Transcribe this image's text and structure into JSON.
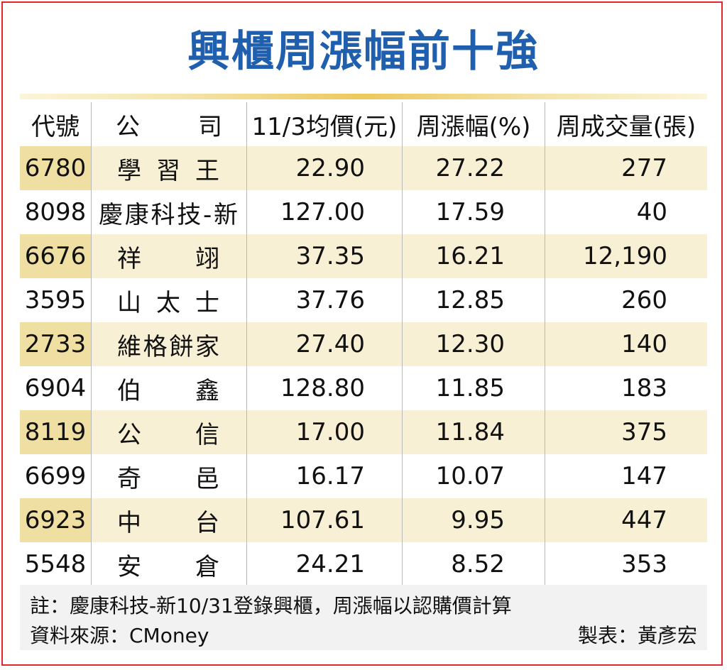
{
  "title": "興櫃周漲幅前十強",
  "headers": [
    "代號",
    "公　　司",
    "11/3均價(元)",
    "周漲幅(%)",
    "周成交量(張)"
  ],
  "chart_data": {
    "type": "table",
    "title": "興櫃周漲幅前十強",
    "columns": [
      "代號",
      "公司",
      "11/3均價(元)",
      "周漲幅(%)",
      "周成交量(張)"
    ],
    "rows": [
      {
        "code": "6780",
        "company": "學習王",
        "price": "22.90",
        "change": "27.22",
        "volume": "277"
      },
      {
        "code": "8098",
        "company": "慶康科技-新",
        "price": "127.00",
        "change": "17.59",
        "volume": "40"
      },
      {
        "code": "6676",
        "company": "祥翊",
        "price": "37.35",
        "change": "16.21",
        "volume": "12,190"
      },
      {
        "code": "3595",
        "company": "山太士",
        "price": "37.76",
        "change": "12.85",
        "volume": "260"
      },
      {
        "code": "2733",
        "company": "維格餅家",
        "price": "27.40",
        "change": "12.30",
        "volume": "140"
      },
      {
        "code": "6904",
        "company": "伯鑫",
        "price": "128.80",
        "change": "11.85",
        "volume": "183"
      },
      {
        "code": "8119",
        "company": "公信",
        "price": "17.00",
        "change": "11.84",
        "volume": "375"
      },
      {
        "code": "6699",
        "company": "奇邑",
        "price": "16.17",
        "change": "10.07",
        "volume": "147"
      },
      {
        "code": "6923",
        "company": "中台",
        "price": "107.61",
        "change": "9.95",
        "volume": "447"
      },
      {
        "code": "5548",
        "company": "安倉",
        "price": "24.21",
        "change": "8.52",
        "volume": "353"
      }
    ]
  },
  "footer": {
    "note": "註：慶康科技-新10/31登錄興櫃，周漲幅以認購價計算",
    "source": "資料來源：CMoney",
    "maker": "製表：黃彥宏"
  },
  "colors": {
    "title": "#1f5fae",
    "border": "#e3262e",
    "row_shade": "#f7f0d4",
    "code_shade": "#efdfa2",
    "footer_bg": "#f2f2f2"
  }
}
